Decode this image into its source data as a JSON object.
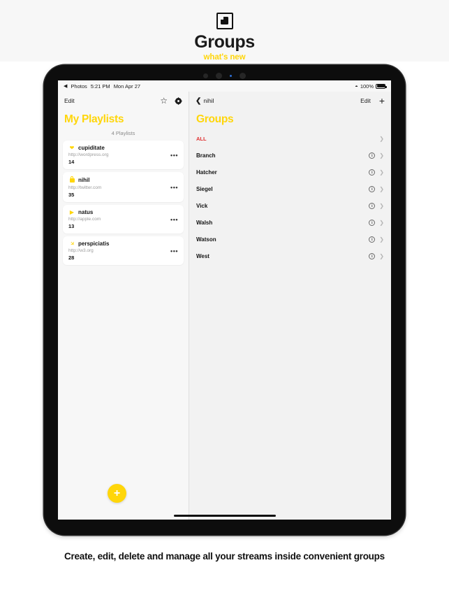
{
  "banner": {
    "icon": "groups-square-icon",
    "title": "Groups",
    "subtitle": "what's new"
  },
  "device": {
    "statusbar": {
      "back_app": "Photos",
      "back_arrow": "◀",
      "time": "5:21 PM",
      "date": "Mon Apr 27",
      "wifi_icon": "wifi-icon",
      "battery_percent": "100%"
    },
    "left_pane": {
      "toolbar": {
        "edit_label": "Edit",
        "star_icon": "star-outline-icon",
        "gear_icon": "gear-icon"
      },
      "title": "My Playlists",
      "count_label": "4 Playlists",
      "playlists": [
        {
          "icon": "heart-icon",
          "name": "cupiditate",
          "url": "http://wordpress.org",
          "count": "14",
          "more": "•••"
        },
        {
          "icon": "lock-icon",
          "name": "nihil",
          "url": "http://twitter.com",
          "count": "35",
          "more": "•••"
        },
        {
          "icon": "play-icon",
          "name": "natus",
          "url": "http://apple.com",
          "count": "13",
          "more": "•••"
        },
        {
          "icon": "airplane-icon",
          "name": "perspiciatis",
          "url": "http://w3.org",
          "count": "28",
          "more": "•••"
        }
      ],
      "fab_label": "+"
    },
    "right_pane": {
      "toolbar": {
        "back_icon": "chevron-left-icon",
        "back_label": "nihil",
        "edit_label": "Edit",
        "add_label": "+"
      },
      "title": "Groups",
      "all_label": "ALL",
      "groups": [
        {
          "name": "Branch",
          "info_icon": "info-circle-icon"
        },
        {
          "name": "Hatcher",
          "info_icon": "info-circle-icon"
        },
        {
          "name": "Siegel",
          "info_icon": "info-circle-icon"
        },
        {
          "name": "Vick",
          "info_icon": "info-circle-icon"
        },
        {
          "name": "Walsh",
          "info_icon": "info-circle-icon"
        },
        {
          "name": "Watson",
          "info_icon": "info-circle-icon"
        },
        {
          "name": "West",
          "info_icon": "info-circle-icon"
        }
      ]
    }
  },
  "caption": "Create, edit, delete and manage all your streams inside convenient groups",
  "colors": {
    "accent_yellow": "#ffd60a",
    "all_red": "#e03131",
    "banner_bg": "#f7f7f7",
    "screen_bg": "#f2f2f2"
  }
}
